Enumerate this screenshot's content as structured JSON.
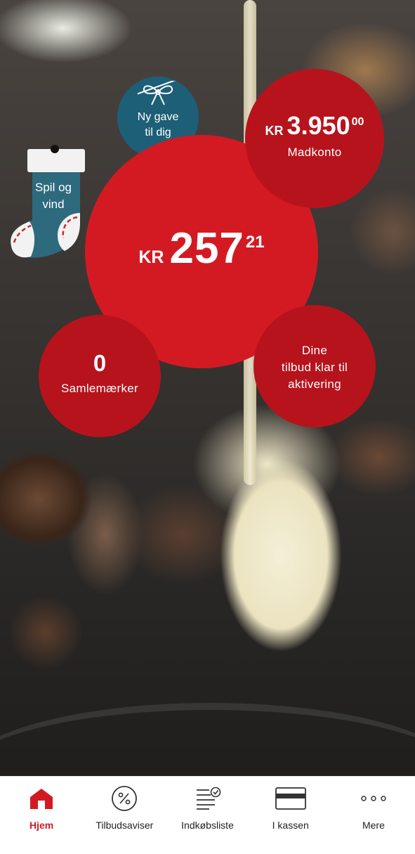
{
  "colors": {
    "brand_red": "#d31a23",
    "dark_red": "#b7131c",
    "gift_teal": "#1d5f77",
    "sock_teal": "#2d6a7d"
  },
  "gift": {
    "icon": "gift-bow-icon",
    "line1": "Ny gave",
    "line2": "til dig"
  },
  "game": {
    "icon": "christmas-stocking-icon",
    "line1": "Spil og",
    "line2": "vind"
  },
  "balance": {
    "currency": "KR",
    "integer": "257",
    "decimals": "21"
  },
  "madkonto": {
    "currency": "KR",
    "integer": "3.950",
    "decimals": "00",
    "label": "Madkonto"
  },
  "offers": {
    "line1": "Dine",
    "line2": "tilbud klar til",
    "line3": "aktivering"
  },
  "stamps": {
    "count": "0",
    "label": "Samlemærker"
  },
  "tabbar": {
    "items": [
      {
        "label": "Hjem",
        "icon": "home-icon",
        "active": true
      },
      {
        "label": "Tilbudsaviser",
        "icon": "percent-icon",
        "active": false
      },
      {
        "label": "Indkøbsliste",
        "icon": "checklist-icon",
        "active": false
      },
      {
        "label": "I kassen",
        "icon": "card-icon",
        "active": false
      },
      {
        "label": "Mere",
        "icon": "more-icon",
        "active": false
      }
    ]
  }
}
